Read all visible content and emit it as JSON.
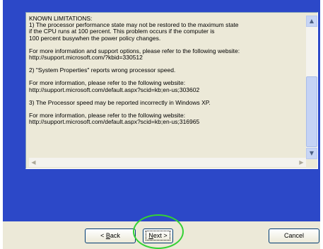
{
  "dialog": {
    "paragraphs": [
      "KNOWN LIMITATIONS:\n1) The processor performance state may not be restored to the maximum state\nif the CPU runs at 100 percent. This problem occurs if the computer is\n100 percent busywhen the power policy changes.",
      "For more information and support options, please refer to the following website:\nhttp://support.microsoft.com/?kbid=330512",
      "2) \"System Properties\" reports wrong processor speed.",
      "For more information, please refer to the following website:\nhttp://support.microsoft.com/default.aspx?scid=kb;en-us;303602",
      "3) The Processor speed may be reported incorrectly in Windows XP.",
      "For more information, please refer to the following website:\nhttp://support.microsoft.com/default.aspx?scid=kb;en-us;316965"
    ]
  },
  "buttons": {
    "back_prefix": "< ",
    "back_mnemonic": "B",
    "back_rest": "ack",
    "next_mnemonic": "N",
    "next_rest": "ext >",
    "cancel": "Cancel"
  },
  "icons": {
    "scroll_up": "chevron-up-icon",
    "scroll_down": "chevron-down-icon",
    "scroll_left": "chevron-left-icon",
    "scroll_right": "chevron-right-icon"
  },
  "colors": {
    "background_blue": "#2c48c8",
    "panel": "#ece9d8",
    "highlight_ring": "#34d134"
  }
}
